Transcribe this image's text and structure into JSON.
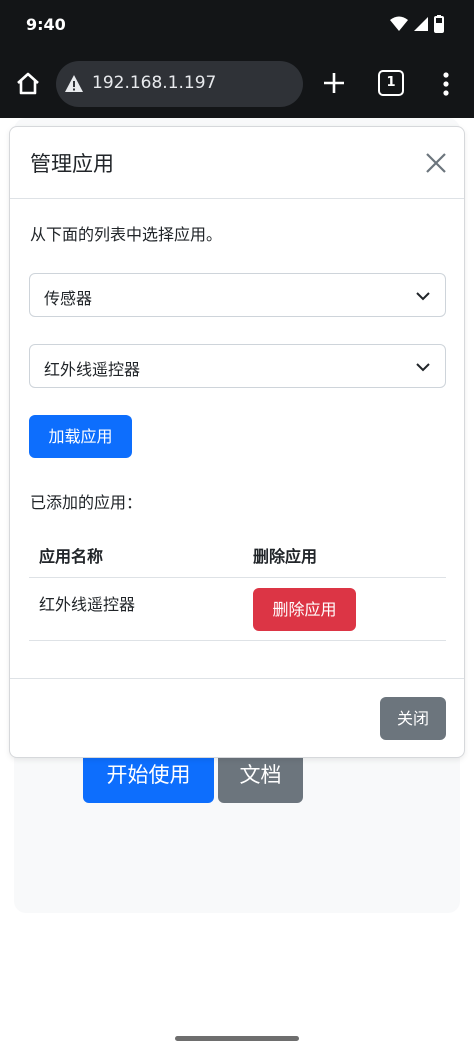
{
  "status_bar": {
    "time": "9:40"
  },
  "browser": {
    "url": "192.168.1.197",
    "tab_count": "1"
  },
  "background_page": {
    "start_button": "开始使用",
    "docs_button": "文档"
  },
  "modal": {
    "title": "管理应用",
    "instruction": "从下面的列表中选择应用。",
    "category_select": {
      "value": "传感器"
    },
    "app_select": {
      "value": "红外线遥控器"
    },
    "load_button": "加载应用",
    "added_label": "已添加的应用：",
    "table": {
      "headers": [
        "应用名称",
        "删除应用"
      ],
      "rows": [
        {
          "name": "红外线遥控器",
          "action": "删除应用"
        }
      ]
    },
    "close_button": "关闭"
  },
  "colors": {
    "primary": "#0d6efd",
    "danger": "#dc3545",
    "secondary": "#6c757d",
    "chrome": "#131517"
  }
}
